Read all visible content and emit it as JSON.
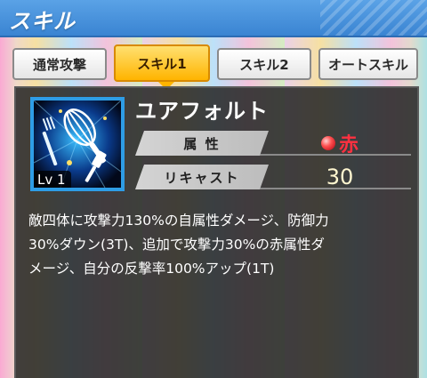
{
  "header": {
    "title": "スキル"
  },
  "tabs": [
    {
      "label": "通常攻撃",
      "active": false
    },
    {
      "label": "スキル1",
      "active": true
    },
    {
      "label": "スキル2",
      "active": false
    },
    {
      "label": "オートスキル",
      "active": false
    }
  ],
  "skill": {
    "name": "ユアフォルト",
    "level": "Lv 1",
    "icon": "whisk-and-kitchen-tools-icon",
    "attribute_label": "属 性",
    "attribute_value": "赤",
    "attribute_color": "#ff3040",
    "recast_label": "リキャスト",
    "recast_value": "30",
    "description_lines": [
      "敵四体に攻撃力130%の自属性ダメージ、防御力",
      "30%ダウン(3T)、追加で攻撃力30%の赤属性ダ",
      "メージ、自分の反撃率100%アップ(1T)"
    ]
  },
  "colors": {
    "header": "#3a84d2",
    "tab_active": "#ffb400",
    "icon_border": "#2e9de6"
  }
}
